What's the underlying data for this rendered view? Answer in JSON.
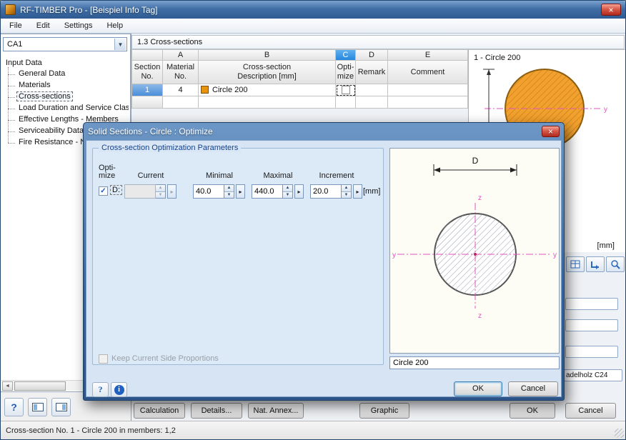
{
  "colors": {
    "titlebar_blue": "#2d5a92",
    "selection_blue": "#2787dd",
    "timber_orange": "#e8930f",
    "axis_magenta": "#e052be",
    "dialog_bg": "#d6e4f3"
  },
  "window": {
    "title": "RF-TIMBER Pro - [Beispiel Info Tag]",
    "menus": [
      "File",
      "Edit",
      "Settings",
      "Help"
    ],
    "status": "Cross-section No. 1 - Circle 200 in members: 1,2"
  },
  "navigator": {
    "case": "CA1",
    "root": "Input Data",
    "items": [
      "General Data",
      "Materials",
      "Cross-sections",
      "Load Duration and Service Clas",
      "Effective Lengths - Members",
      "Serviceability Data",
      "Fire Resistance - N"
    ]
  },
  "table": {
    "title": "1.3 Cross-sections",
    "letters": [
      "A",
      "B",
      "C",
      "D",
      "E"
    ],
    "headers": {
      "section": [
        "Section",
        "No."
      ],
      "material": [
        "Material",
        "No."
      ],
      "description": [
        "Cross-section",
        "Description [mm]"
      ],
      "optimize": [
        "Opti-",
        "mize"
      ],
      "remark": "Remark",
      "comment": "Comment"
    },
    "row1": {
      "no": "1",
      "material": "4",
      "description": "Circle 200"
    }
  },
  "preview": {
    "title": "1 - Circle 200",
    "unit": "[mm]",
    "axis_y": "y",
    "material_text": "adelholz C24"
  },
  "bottom_bar": {
    "calculation": "Calculation",
    "details": "Details...",
    "nat_annex": "Nat. Annex...",
    "graphic": "Graphic",
    "ok": "OK",
    "cancel": "Cancel"
  },
  "dialog": {
    "title": "Solid Sections - Circle : Optimize",
    "group_title": "Cross-section Optimization Parameters",
    "headers": {
      "optimize": [
        "Opti-",
        "mize"
      ],
      "current": "Current",
      "minimal": "Minimal",
      "maximal": "Maximal",
      "increment": "Increment"
    },
    "param": {
      "label": "D:",
      "checked": true,
      "current": "",
      "minimal": "40.0",
      "maximal": "440.0",
      "increment": "20.0",
      "unit": "[mm]"
    },
    "keep_proportions": "Keep Current Side Proportions",
    "section_name": "Circle 200",
    "diagram": {
      "dim": "D",
      "y": "y",
      "z": "z"
    },
    "help": "?",
    "info": "i",
    "ok": "OK",
    "cancel": "Cancel"
  }
}
